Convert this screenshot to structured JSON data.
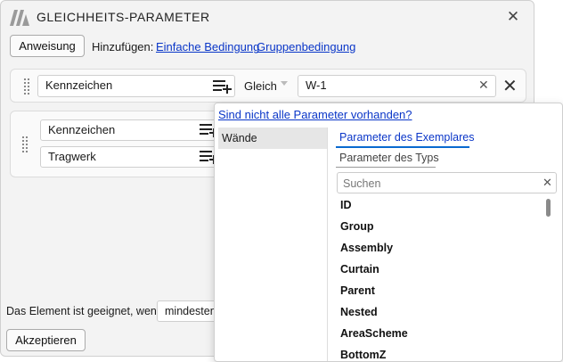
{
  "window": {
    "title": "GLEICHHEITS-PARAMETER"
  },
  "toolbar": {
    "anweisung_label": "Anweisung",
    "hinzufuegen_label": "Hinzufügen:",
    "link_simple": "Einfache Bedingung",
    "link_group": "Gruppenbedingung"
  },
  "rule1": {
    "parameter": "Kennzeichen",
    "operator": "Gleich",
    "value": "W-1"
  },
  "group": {
    "param1": "Kennzeichen",
    "param2": "Tragwerk"
  },
  "footer": {
    "condition_text": "Das Element ist geeignet, wenn",
    "mode_value": "mindestens",
    "accept_label": "Akzeptieren"
  },
  "popup": {
    "missing_link": "Sind nicht alle Parameter vorhanden?",
    "category": "Wände",
    "tab_instance": "Parameter des Exemplares",
    "tab_type": "Parameter des Typs",
    "search_placeholder": "Suchen",
    "params": [
      "ID",
      "Group",
      "Assembly",
      "Curtain",
      "Parent",
      "Nested",
      "AreaScheme",
      "BottomZ"
    ]
  }
}
